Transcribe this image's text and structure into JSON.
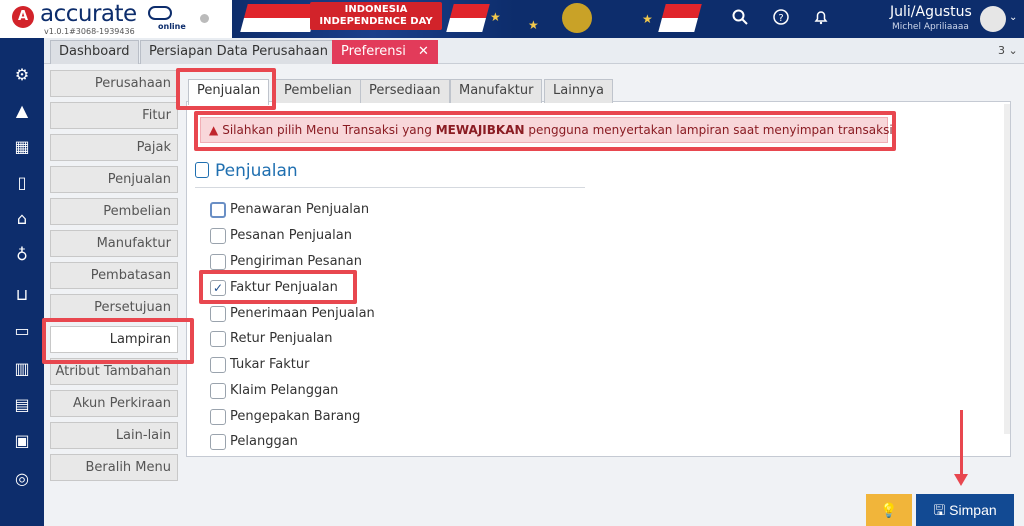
{
  "header": {
    "logo_text": "accurate",
    "logo_sub": "online",
    "version": "v1.0.1#3068-1939436",
    "banner_line1": "INDONESIA",
    "banner_line2": "INDEPENDENCE DAY",
    "user_period": "Juli/Agustus",
    "user_name": "Michel Apriliaaaa",
    "icons": [
      "search-icon",
      "help-icon",
      "bell-icon",
      "user-avatar",
      "chevron-down-icon"
    ]
  },
  "rail": {
    "icons": [
      "gear-icon",
      "pyramid-icon",
      "building-icon",
      "book-icon",
      "bank-icon",
      "money-bag-icon",
      "cart-icon",
      "trolley-icon",
      "factory-icon",
      "conveyor-icon",
      "tax-icon",
      "report-icon"
    ]
  },
  "tabs": [
    {
      "label": "Dashboard"
    },
    {
      "label": "Persiapan Data Perusahaan"
    },
    {
      "label": "Preferensi",
      "close": "✕"
    }
  ],
  "tab_count": "3 ⌄",
  "side_menu": [
    "Perusahaan",
    "Fitur",
    "Pajak",
    "Penjualan",
    "Pembelian",
    "Manufaktur",
    "Pembatasan",
    "Persetujuan",
    "Lampiran",
    "Atribut Tambahan",
    "Akun Perkiraan",
    "Lain-lain",
    "Beralih Menu"
  ],
  "subtabs": [
    "Penjualan",
    "Pembelian",
    "Persediaan",
    "Manufaktur",
    "Lainnya"
  ],
  "alert": {
    "icon": "▲",
    "before": "Silahkan pilih Menu Transaksi yang ",
    "bold": "MEWAJIBKAN",
    "after": " pengguna menyertakan lampiran saat menyimpan transaksi."
  },
  "section_title": "Penjualan",
  "checklist": [
    {
      "label": "Penawaran Penjualan",
      "checked": false
    },
    {
      "label": "Pesanan Penjualan",
      "checked": false
    },
    {
      "label": "Pengiriman Pesanan",
      "checked": false
    },
    {
      "label": "Faktur Penjualan",
      "checked": true
    },
    {
      "label": "Penerimaan Penjualan",
      "checked": false
    },
    {
      "label": "Retur Penjualan",
      "checked": false
    },
    {
      "label": "Tukar Faktur",
      "checked": false
    },
    {
      "label": "Klaim Pelanggan",
      "checked": false
    },
    {
      "label": "Pengepakan Barang",
      "checked": false
    },
    {
      "label": "Pelanggan",
      "checked": false
    }
  ],
  "buttons": {
    "bulb_icon": "💡",
    "save_icon": "🖫",
    "save_label": "Simpan"
  },
  "colors": {
    "navy": "#0d2d6c",
    "active_tab": "#e23b5a",
    "save": "#124a93",
    "bulb": "#f1b53a",
    "annotation": "#e8474f"
  }
}
